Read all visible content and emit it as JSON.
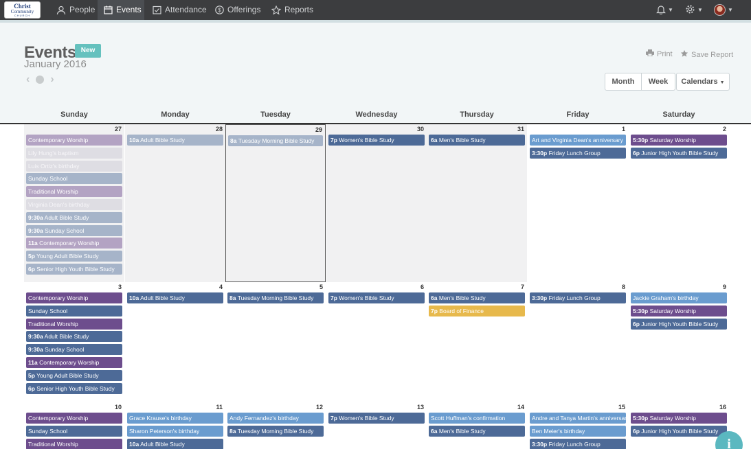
{
  "nav": {
    "logo": {
      "line1": "Christ",
      "line2": "Community",
      "line3": "CHURCH"
    },
    "items": [
      {
        "label": "People",
        "icon": "person-icon"
      },
      {
        "label": "Events",
        "icon": "calendar-icon",
        "active": true
      },
      {
        "label": "Attendance",
        "icon": "checkbox-icon"
      },
      {
        "label": "Offerings",
        "icon": "dollar-icon"
      },
      {
        "label": "Reports",
        "icon": "star-icon"
      }
    ],
    "right": [
      "bell-icon",
      "gear-icon",
      "avatar"
    ]
  },
  "header": {
    "title": "Events",
    "badge": "New",
    "subtitle": "January 2016",
    "print_label": "Print",
    "save_label": "Save Report",
    "month_label": "Month",
    "week_label": "Week",
    "calendars_label": "Calendars"
  },
  "days": [
    "Sunday",
    "Monday",
    "Tuesday",
    "Wednesday",
    "Thursday",
    "Friday",
    "Saturday"
  ],
  "colors": {
    "purple": "#6d4d8d",
    "blue": "#4d6a97",
    "light_blue": "#6a9ccf",
    "gold": "#e7b94c",
    "faded_purple": "#b3a3c3",
    "faded_blue": "#a6b4c9",
    "faded_pink": "#dedde3",
    "accent": "#4fb3b3"
  },
  "weeks": [
    {
      "days": [
        {
          "num": "27",
          "other": true,
          "events": [
            {
              "text": "Contemporary Worship",
              "color": "faded_purple"
            },
            {
              "text": "Lily Hung's baptism",
              "color": "faded_pink"
            },
            {
              "text": "Luis Ortiz's birthday",
              "color": "faded_pink"
            },
            {
              "text": "Sunday School",
              "color": "faded_blue"
            },
            {
              "text": "Traditional Worship",
              "color": "faded_purple"
            },
            {
              "text": "Virginia Dean's birthday",
              "color": "faded_pink"
            },
            {
              "time": "9:30a",
              "text": "Adult Bible Study",
              "color": "faded_blue"
            },
            {
              "time": "9:30a",
              "text": "Sunday School",
              "color": "faded_blue"
            },
            {
              "time": "11a",
              "text": "Contemporary Worship",
              "color": "faded_purple"
            },
            {
              "time": "5p",
              "text": "Young Adult Bible Study",
              "color": "faded_blue"
            },
            {
              "time": "6p",
              "text": "Senior High Youth Bible Study",
              "color": "faded_blue"
            }
          ]
        },
        {
          "num": "28",
          "other": true,
          "events": [
            {
              "time": "10a",
              "text": "Adult Bible Study",
              "color": "faded_blue"
            }
          ]
        },
        {
          "num": "29",
          "other": true,
          "today": true,
          "events": [
            {
              "time": "8a",
              "text": "Tuesday Morning Bible Study",
              "color": "faded_blue"
            }
          ]
        },
        {
          "num": "30",
          "other": true,
          "events": [
            {
              "time": "7p",
              "text": "Women's Bible Study",
              "color": "blue"
            }
          ]
        },
        {
          "num": "31",
          "other": true,
          "events": [
            {
              "time": "6a",
              "text": "Men's Bible Study",
              "color": "blue"
            }
          ]
        },
        {
          "num": "1",
          "events": [
            {
              "text": "Art and Virginia Dean's anniversary",
              "color": "light_blue"
            },
            {
              "time": "3:30p",
              "text": "Friday Lunch Group",
              "color": "blue"
            }
          ]
        },
        {
          "num": "2",
          "events": [
            {
              "time": "5:30p",
              "text": "Saturday Worship",
              "color": "purple"
            },
            {
              "time": "6p",
              "text": "Junior High Youth Bible Study",
              "color": "blue"
            }
          ]
        }
      ]
    },
    {
      "days": [
        {
          "num": "3",
          "events": [
            {
              "text": "Contemporary Worship",
              "color": "purple"
            },
            {
              "text": "Sunday School",
              "color": "blue"
            },
            {
              "text": "Traditional Worship",
              "color": "purple"
            },
            {
              "time": "9:30a",
              "text": "Adult Bible Study",
              "color": "blue"
            },
            {
              "time": "9:30a",
              "text": "Sunday School",
              "color": "blue"
            },
            {
              "time": "11a",
              "text": "Contemporary Worship",
              "color": "purple"
            },
            {
              "time": "5p",
              "text": "Young Adult Bible Study",
              "color": "blue"
            },
            {
              "time": "6p",
              "text": "Senior High Youth Bible Study",
              "color": "blue"
            }
          ]
        },
        {
          "num": "4",
          "events": [
            {
              "time": "10a",
              "text": "Adult Bible Study",
              "color": "blue"
            }
          ]
        },
        {
          "num": "5",
          "events": [
            {
              "time": "8a",
              "text": "Tuesday Morning Bible Study",
              "color": "blue"
            }
          ]
        },
        {
          "num": "6",
          "events": [
            {
              "time": "7p",
              "text": "Women's Bible Study",
              "color": "blue"
            }
          ]
        },
        {
          "num": "7",
          "events": [
            {
              "time": "6a",
              "text": "Men's Bible Study",
              "color": "blue"
            },
            {
              "time": "7p",
              "text": "Board of Finance",
              "color": "gold"
            }
          ]
        },
        {
          "num": "8",
          "events": [
            {
              "time": "3:30p",
              "text": "Friday Lunch Group",
              "color": "blue"
            }
          ]
        },
        {
          "num": "9",
          "events": [
            {
              "text": "Jackie Graham's birthday",
              "color": "light_blue"
            },
            {
              "time": "5:30p",
              "text": "Saturday Worship",
              "color": "purple"
            },
            {
              "time": "6p",
              "text": "Junior High Youth Bible Study",
              "color": "blue"
            }
          ]
        }
      ]
    },
    {
      "days": [
        {
          "num": "10",
          "events": [
            {
              "text": "Contemporary Worship",
              "color": "purple"
            },
            {
              "text": "Sunday School",
              "color": "blue"
            },
            {
              "text": "Traditional Worship",
              "color": "purple"
            }
          ]
        },
        {
          "num": "11",
          "events": [
            {
              "text": "Grace Krause's birthday",
              "color": "light_blue"
            },
            {
              "text": "Sharon Peterson's birthday",
              "color": "light_blue"
            },
            {
              "time": "10a",
              "text": "Adult Bible Study",
              "color": "blue"
            }
          ]
        },
        {
          "num": "12",
          "events": [
            {
              "text": "Andy Fernandez's birthday",
              "color": "light_blue"
            },
            {
              "time": "8a",
              "text": "Tuesday Morning Bible Study",
              "color": "blue"
            }
          ]
        },
        {
          "num": "13",
          "events": [
            {
              "time": "7p",
              "text": "Women's Bible Study",
              "color": "blue"
            }
          ]
        },
        {
          "num": "14",
          "events": [
            {
              "text": "Scott Huffman's confirmation",
              "color": "light_blue"
            },
            {
              "time": "6a",
              "text": "Men's Bible Study",
              "color": "blue"
            }
          ]
        },
        {
          "num": "15",
          "events": [
            {
              "text": "Andre and Tanya Martin's anniversary",
              "color": "light_blue"
            },
            {
              "text": "Ben Meier's birthday",
              "color": "light_blue"
            },
            {
              "time": "3:30p",
              "text": "Friday Lunch Group",
              "color": "blue"
            }
          ]
        },
        {
          "num": "16",
          "events": [
            {
              "time": "5:30p",
              "text": "Saturday Worship",
              "color": "purple"
            },
            {
              "time": "6p",
              "text": "Junior High Youth Bible Study",
              "color": "blue"
            }
          ]
        }
      ]
    }
  ]
}
